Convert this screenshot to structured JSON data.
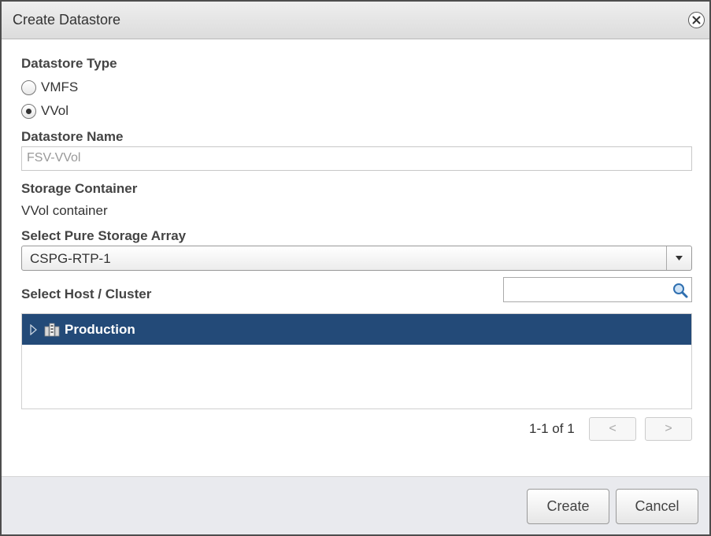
{
  "dialog": {
    "title": "Create Datastore"
  },
  "datastore_type": {
    "label": "Datastore Type",
    "options": [
      {
        "label": "VMFS",
        "selected": false
      },
      {
        "label": "VVol",
        "selected": true
      }
    ]
  },
  "datastore_name": {
    "label": "Datastore Name",
    "value": "FSV-VVol"
  },
  "storage_container": {
    "label": "Storage Container",
    "value": "VVol container"
  },
  "array_select": {
    "label": "Select Pure Storage Array",
    "value": "CSPG-RTP-1"
  },
  "host_cluster": {
    "label": "Select Host / Cluster",
    "search_value": "",
    "tree": [
      {
        "label": "Production",
        "icon": "cluster-icon",
        "selected": true
      }
    ],
    "selected_color": "#234a78"
  },
  "pager": {
    "text": "1-1 of 1",
    "prev": "<",
    "next": ">"
  },
  "footer": {
    "create_label": "Create",
    "cancel_label": "Cancel"
  }
}
